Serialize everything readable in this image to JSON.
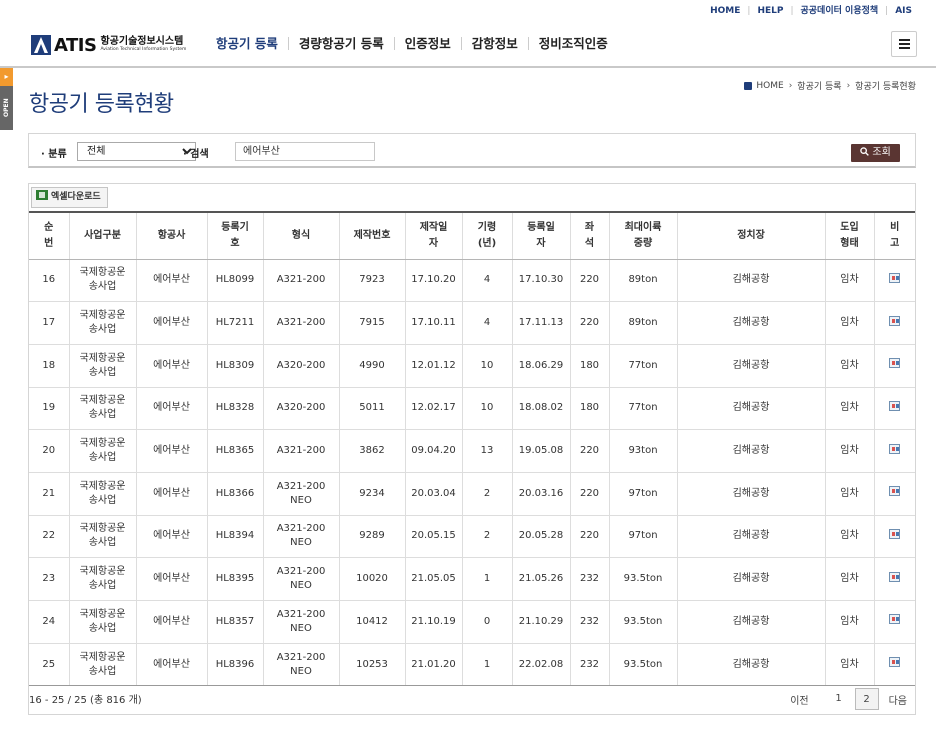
{
  "topbar": {
    "links": [
      "HOME",
      "HELP",
      "공공데이터 이용정책",
      "AIS"
    ]
  },
  "logo": {
    "brand": "ATIS",
    "kor": "항공기술정보시스템",
    "eng": "Aviation Technical Information System"
  },
  "gnb": [
    "항공기 등록",
    "경량항공기 등록",
    "인증정보",
    "감항정보",
    "정비조직인증"
  ],
  "sidetab": {
    "label": "OPEN"
  },
  "page": {
    "title": "항공기 등록현황"
  },
  "breadcrumb": [
    "HOME",
    "항공기 등록",
    "항공기 등록현황"
  ],
  "search": {
    "category_label": "· 분류",
    "category_value": "전체",
    "keyword_label": "· 검색",
    "keyword_value": "에어부산",
    "button_label": "조회"
  },
  "excel_button": "엑셀다운로드",
  "table": {
    "headers": [
      "순\n번",
      "사업구분",
      "항공사",
      "등록기\n호",
      "형식",
      "제작번호",
      "제작일\n자",
      "기령\n(년)",
      "등록일\n자",
      "좌\n석",
      "최대이륙\n중량",
      "정치장",
      "도입\n형태",
      "비\n고"
    ],
    "rows": [
      [
        "16",
        "국제항공운\n송사업",
        "에어부산",
        "HL8099",
        "A321-200",
        "7923",
        "17.10.20",
        "4",
        "17.10.30",
        "220",
        "89ton",
        "김해공항",
        "임차"
      ],
      [
        "17",
        "국제항공운\n송사업",
        "에어부산",
        "HL7211",
        "A321-200",
        "7915",
        "17.10.11",
        "4",
        "17.11.13",
        "220",
        "89ton",
        "김해공항",
        "임차"
      ],
      [
        "18",
        "국제항공운\n송사업",
        "에어부산",
        "HL8309",
        "A320-200",
        "4990",
        "12.01.12",
        "10",
        "18.06.29",
        "180",
        "77ton",
        "김해공항",
        "임차"
      ],
      [
        "19",
        "국제항공운\n송사업",
        "에어부산",
        "HL8328",
        "A320-200",
        "5011",
        "12.02.17",
        "10",
        "18.08.02",
        "180",
        "77ton",
        "김해공항",
        "임차"
      ],
      [
        "20",
        "국제항공운\n송사업",
        "에어부산",
        "HL8365",
        "A321-200",
        "3862",
        "09.04.20",
        "13",
        "19.05.08",
        "220",
        "93ton",
        "김해공항",
        "임차"
      ],
      [
        "21",
        "국제항공운\n송사업",
        "에어부산",
        "HL8366",
        "A321-200\nNEO",
        "9234",
        "20.03.04",
        "2",
        "20.03.16",
        "220",
        "97ton",
        "김해공항",
        "임차"
      ],
      [
        "22",
        "국제항공운\n송사업",
        "에어부산",
        "HL8394",
        "A321-200\nNEO",
        "9289",
        "20.05.15",
        "2",
        "20.05.28",
        "220",
        "97ton",
        "김해공항",
        "임차"
      ],
      [
        "23",
        "국제항공운\n송사업",
        "에어부산",
        "HL8395",
        "A321-200\nNEO",
        "10020",
        "21.05.05",
        "1",
        "21.05.26",
        "232",
        "93.5ton",
        "김해공항",
        "임차"
      ],
      [
        "24",
        "국제항공운\n송사업",
        "에어부산",
        "HL8357",
        "A321-200\nNEO",
        "10412",
        "21.10.19",
        "0",
        "21.10.29",
        "232",
        "93.5ton",
        "김해공항",
        "임차"
      ],
      [
        "25",
        "국제항공운\n송사업",
        "에어부산",
        "HL8396",
        "A321-200\nNEO",
        "10253",
        "21.01.20",
        "1",
        "22.02.08",
        "232",
        "93.5ton",
        "김해공항",
        "임차"
      ]
    ]
  },
  "footer": {
    "info": "16 - 25 / 25 (총 816 개)"
  },
  "pager": {
    "prev": "이전",
    "pages": [
      "1",
      "2"
    ],
    "current": "2",
    "next": "다음"
  }
}
